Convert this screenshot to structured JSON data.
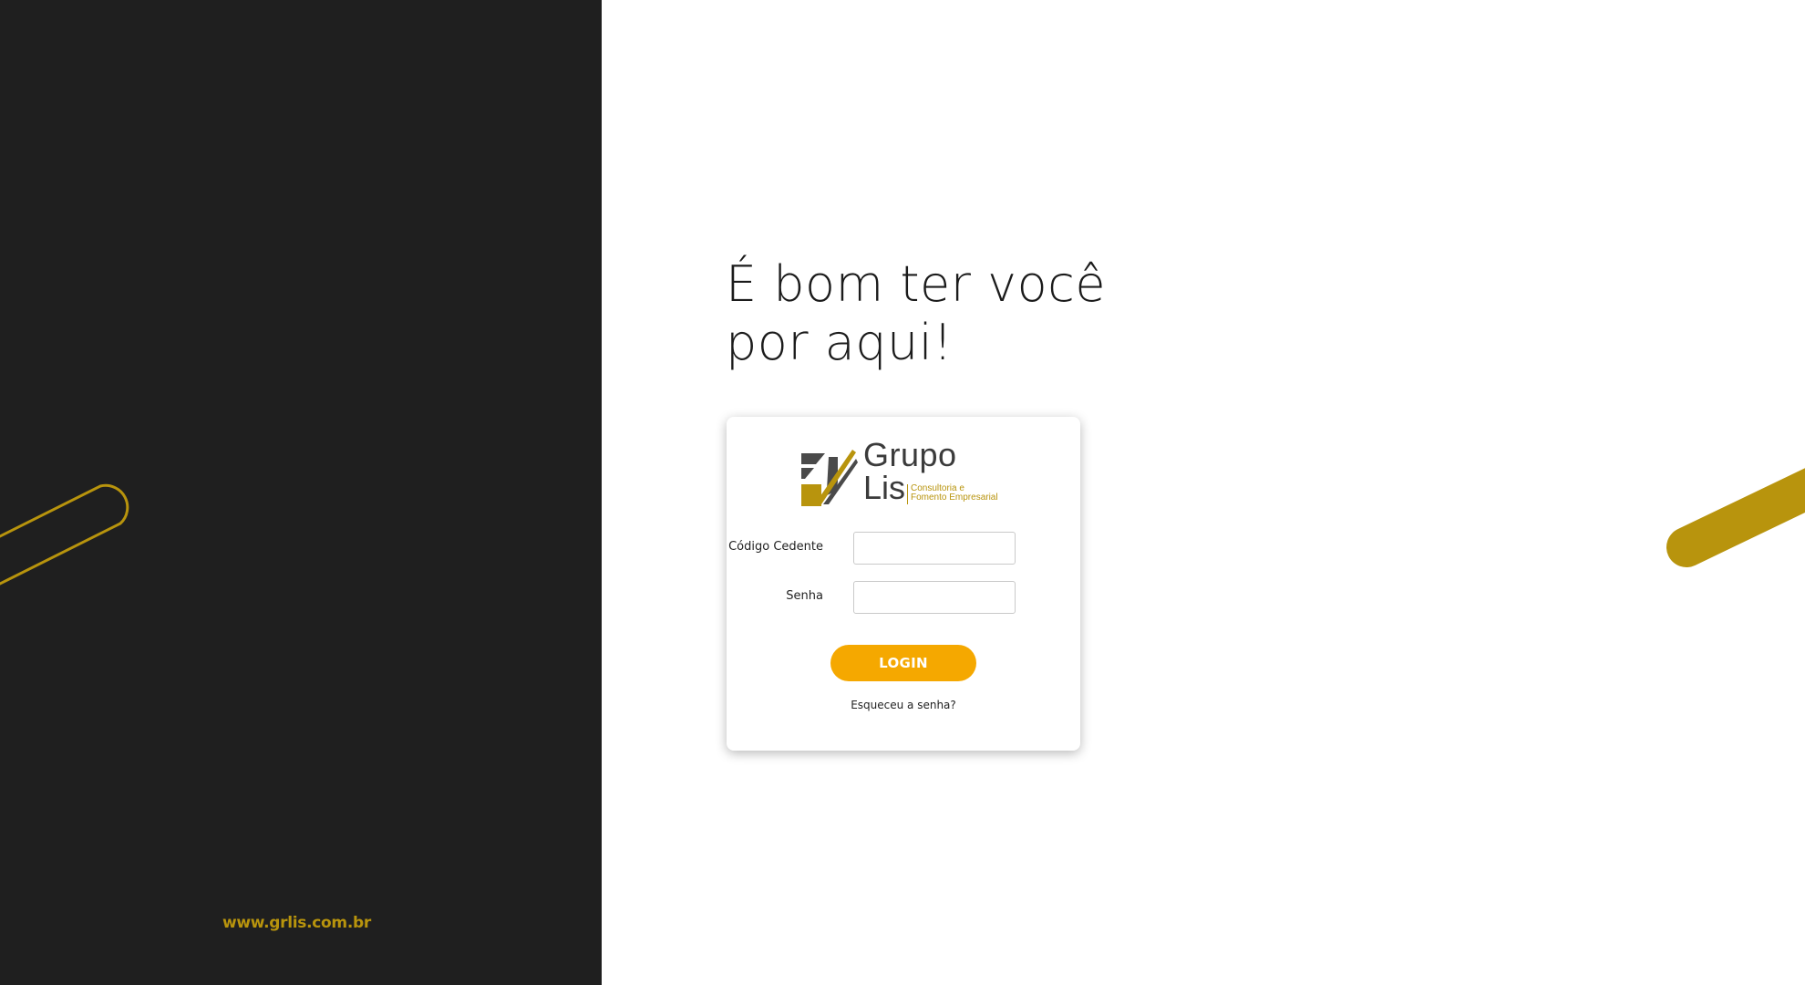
{
  "left_panel": {
    "site_url": "www.grlis.com.br"
  },
  "headline": {
    "line1": "É bom ter você",
    "line2": "por aqui!"
  },
  "logo": {
    "word1": "Grupo",
    "word2": "Lis",
    "tagline_line1": "Consultoria e",
    "tagline_line2": "Fomento Empresarial"
  },
  "form": {
    "codigo_label": "Código Cedente",
    "codigo_value": "",
    "senha_label": "Senha",
    "senha_value": "",
    "login_label": "LOGIN",
    "forgot_label": "Esqueceu a senha?"
  },
  "colors": {
    "dark_panel": "#1f1f1f",
    "gold": "#b8940d",
    "button": "#f5a800",
    "logo_gray": "#3b3b3b"
  },
  "icons": {
    "logo_mark": "grupo-lis-logo-icon",
    "left_decoration": "outlined-pill-stroke",
    "right_decoration": "solid-pill-stroke"
  }
}
